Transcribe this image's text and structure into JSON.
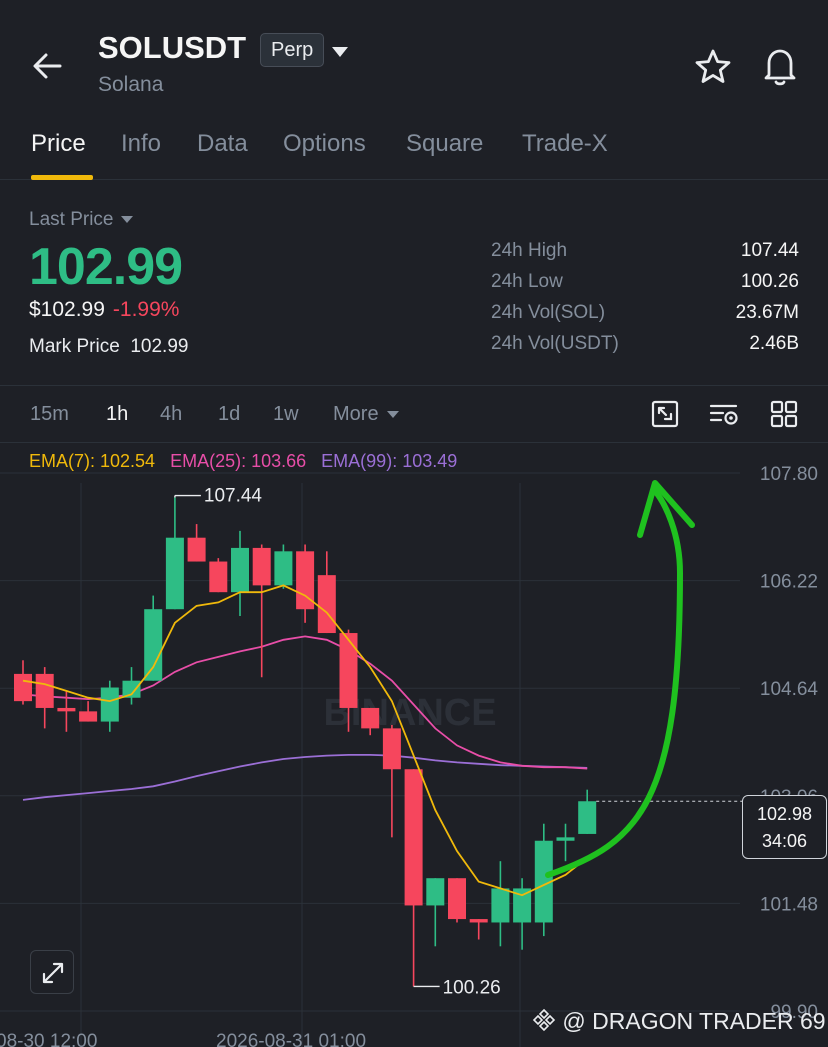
{
  "header": {
    "symbol": "SOLUSDT",
    "contract_badge": "Perp",
    "coin_name": "Solana",
    "icons": [
      "back-arrow-icon",
      "chevron-down-icon",
      "star-icon",
      "bell-icon"
    ]
  },
  "tabs": [
    {
      "label": "Price",
      "active": true
    },
    {
      "label": "Info",
      "active": false
    },
    {
      "label": "Data",
      "active": false
    },
    {
      "label": "Options",
      "active": false
    },
    {
      "label": "Square",
      "active": false
    },
    {
      "label": "Trade-X",
      "active": false
    }
  ],
  "ticker": {
    "last_price_label": "Last Price",
    "last_price": "102.99",
    "usd_price": "$102.99",
    "change_pct": "-1.99%",
    "mark_price_label": "Mark Price",
    "mark_price": "102.99",
    "stats": [
      {
        "label": "24h High",
        "value": "107.44"
      },
      {
        "label": "24h Low",
        "value": "100.26"
      },
      {
        "label": "24h Vol(SOL)",
        "value": "23.67M"
      },
      {
        "label": "24h Vol(USDT)",
        "value": "2.46B"
      }
    ]
  },
  "intervals": [
    {
      "label": "15m",
      "active": false
    },
    {
      "label": "1h",
      "active": true
    },
    {
      "label": "4h",
      "active": false
    },
    {
      "label": "1d",
      "active": false
    },
    {
      "label": "1w",
      "active": false
    },
    {
      "label": "More",
      "active": false
    }
  ],
  "tools": [
    "fullscreen-chart-icon",
    "chart-settings-icon",
    "layout-grid-icon"
  ],
  "ema": {
    "ema7": "EMA(7): 102.54",
    "ema25": "EMA(25): 103.66",
    "ema99": "EMA(99): 103.49"
  },
  "colors": {
    "up": "#2ebd85",
    "down": "#f6465d",
    "accent": "#f0b90b",
    "ema7": "#f0b90b",
    "ema25": "#e84ea8",
    "ema99": "#9b6fd6",
    "annotation_arrow": "#1fc11f"
  },
  "chart_data": {
    "type": "candlestick",
    "y_ticks": [
      "107.80",
      "106.22",
      "104.64",
      "103.06",
      "101.48",
      "99.90"
    ],
    "ylim": [
      99.9,
      107.8
    ],
    "x_ticks": [
      "08-30 12:00",
      "2026-08-31 01:00"
    ],
    "watermark_text": "BINANCE",
    "high_label": "107.44",
    "low_label": "100.26",
    "current_price": "102.98",
    "countdown": "34:06",
    "candles": [
      {
        "o": 104.85,
        "h": 105.05,
        "c": 104.45,
        "l": 104.4
      },
      {
        "o": 104.85,
        "h": 104.95,
        "c": 104.35,
        "l": 104.05
      },
      {
        "o": 104.35,
        "h": 104.6,
        "c": 104.3,
        "l": 104.0
      },
      {
        "o": 104.3,
        "h": 104.45,
        "c": 104.15,
        "l": 104.15
      },
      {
        "o": 104.15,
        "h": 104.75,
        "c": 104.65,
        "l": 104.0
      },
      {
        "o": 104.5,
        "h": 104.95,
        "c": 104.75,
        "l": 104.4
      },
      {
        "o": 104.75,
        "h": 106.0,
        "c": 105.8,
        "l": 104.75
      },
      {
        "o": 105.8,
        "h": 107.44,
        "c": 106.85,
        "l": 105.8
      },
      {
        "o": 106.85,
        "h": 107.05,
        "c": 106.5,
        "l": 106.5
      },
      {
        "o": 106.5,
        "h": 106.55,
        "c": 106.05,
        "l": 106.05
      },
      {
        "o": 106.05,
        "h": 106.95,
        "c": 106.7,
        "l": 105.7
      },
      {
        "o": 106.7,
        "h": 106.75,
        "c": 106.15,
        "l": 104.8
      },
      {
        "o": 106.15,
        "h": 106.75,
        "c": 106.65,
        "l": 106.1
      },
      {
        "o": 106.65,
        "h": 106.75,
        "c": 105.8,
        "l": 105.6
      },
      {
        "o": 106.3,
        "h": 106.65,
        "c": 105.45,
        "l": 105.45
      },
      {
        "o": 105.45,
        "h": 105.5,
        "c": 104.35,
        "l": 104.0
      },
      {
        "o": 104.35,
        "h": 104.35,
        "c": 104.05,
        "l": 103.95
      },
      {
        "o": 104.05,
        "h": 104.1,
        "c": 103.45,
        "l": 102.45
      },
      {
        "o": 103.45,
        "h": 103.45,
        "c": 101.45,
        "l": 100.26
      },
      {
        "o": 101.45,
        "h": 101.85,
        "c": 101.85,
        "l": 100.85
      },
      {
        "o": 101.85,
        "h": 101.85,
        "c": 101.25,
        "l": 101.2
      },
      {
        "o": 101.25,
        "h": 101.25,
        "c": 101.2,
        "l": 100.95
      },
      {
        "o": 101.2,
        "h": 102.1,
        "c": 101.7,
        "l": 100.85
      },
      {
        "o": 101.2,
        "h": 101.85,
        "c": 101.7,
        "l": 100.8
      },
      {
        "o": 101.2,
        "h": 102.65,
        "c": 102.4,
        "l": 101.0
      },
      {
        "o": 102.4,
        "h": 102.65,
        "c": 102.45,
        "l": 102.1
      },
      {
        "o": 102.5,
        "h": 103.15,
        "c": 102.98,
        "l": 102.5
      }
    ],
    "ema7_values": [
      104.75,
      104.7,
      104.6,
      104.5,
      104.45,
      104.55,
      104.95,
      105.6,
      105.85,
      105.9,
      106.05,
      106.05,
      106.15,
      106.0,
      105.75,
      105.35,
      104.95,
      104.45,
      103.65,
      102.85,
      102.25,
      101.8,
      101.7,
      101.6,
      101.75,
      101.9,
      102.15
    ],
    "ema25_values": [
      104.55,
      104.52,
      104.5,
      104.48,
      104.5,
      104.55,
      104.68,
      104.88,
      105.02,
      105.1,
      105.18,
      105.25,
      105.35,
      105.4,
      105.35,
      105.2,
      105.0,
      104.75,
      104.4,
      104.05,
      103.8,
      103.65,
      103.55,
      103.5,
      103.48,
      103.48,
      103.46
    ],
    "ema99_values": [
      103.0,
      103.04,
      103.07,
      103.1,
      103.13,
      103.16,
      103.2,
      103.27,
      103.35,
      103.42,
      103.49,
      103.55,
      103.6,
      103.63,
      103.65,
      103.66,
      103.66,
      103.65,
      103.62,
      103.58,
      103.55,
      103.53,
      103.51,
      103.5,
      103.49,
      103.48,
      103.47
    ]
  },
  "watermark": "@ DRAGON TRADER 69"
}
